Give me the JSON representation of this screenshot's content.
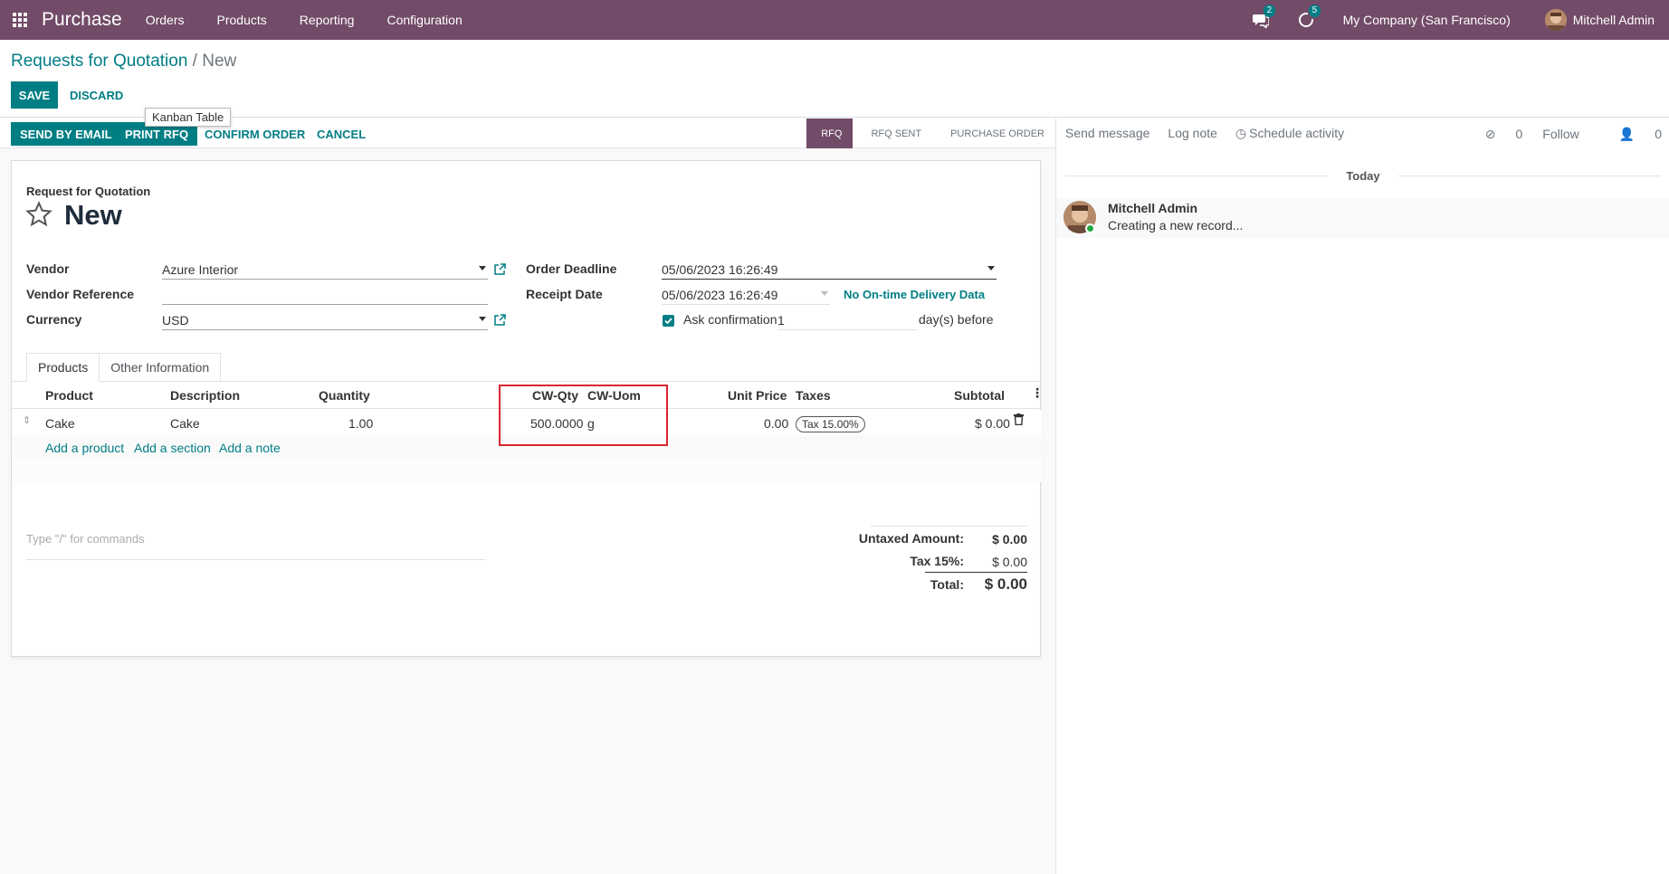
{
  "navbar": {
    "brand": "Purchase",
    "menu": [
      "Orders",
      "Products",
      "Reporting",
      "Configuration"
    ],
    "messages_badge": "2",
    "activities_badge": "5",
    "company": "My Company (San Francisco)",
    "user": "Mitchell Admin"
  },
  "breadcrumb": {
    "parent": "Requests for Quotation",
    "separator": "/",
    "current": "New"
  },
  "actions": {
    "save": "SAVE",
    "discard": "DISCARD"
  },
  "tooltip": "Kanban Table",
  "statusbar": {
    "send_email": "SEND BY EMAIL",
    "print_rfq": "PRINT RFQ",
    "confirm": "CONFIRM ORDER",
    "cancel": "CANCEL",
    "stages": [
      "RFQ",
      "RFQ SENT",
      "PURCHASE ORDER"
    ],
    "active_stage": "RFQ"
  },
  "chatter": {
    "send_message": "Send message",
    "log_note": "Log note",
    "schedule_activity": "Schedule activity",
    "attachments": "0",
    "follow": "Follow",
    "followers": "0",
    "date_separator": "Today",
    "message": {
      "author": "Mitchell Admin",
      "body": "Creating a new record..."
    }
  },
  "form": {
    "label": "Request for Quotation",
    "name": "New",
    "vendor_label": "Vendor",
    "vendor_value": "Azure Interior",
    "vendor_ref_label": "Vendor Reference",
    "vendor_ref_value": "",
    "currency_label": "Currency",
    "currency_value": "USD",
    "order_deadline_label": "Order Deadline",
    "order_deadline_value": "05/06/2023 16:26:49",
    "receipt_date_label": "Receipt Date",
    "receipt_date_value": "05/06/2023 16:26:49",
    "on_time_link": "No On-time Delivery Data",
    "ask_confirmation_label": "Ask confirmation",
    "ask_confirmation_checked": true,
    "confirmation_days": "1",
    "days_before": "day(s) before"
  },
  "tabs": [
    "Products",
    "Other Information"
  ],
  "table": {
    "headers": {
      "product": "Product",
      "description": "Description",
      "quantity": "Quantity",
      "cw_qty": "CW-Qty",
      "cw_uom": "CW-Uom",
      "unit_price": "Unit Price",
      "taxes": "Taxes",
      "subtotal": "Subtotal"
    },
    "rows": [
      {
        "product": "Cake",
        "description": "Cake",
        "quantity": "1.00",
        "cw_qty": "500.0000",
        "cw_uom": "g",
        "unit_price": "0.00",
        "tax": "Tax 15.00%",
        "subtotal": "$ 0.00"
      }
    ],
    "add_product": "Add a product",
    "add_section": "Add a section",
    "add_note": "Add a note"
  },
  "notes_placeholder": "Type \"/\" for commands",
  "totals": {
    "untaxed_label": "Untaxed Amount:",
    "untaxed_value": "$ 0.00",
    "tax_label": "Tax 15%:",
    "tax_value": "$ 0.00",
    "total_label": "Total:",
    "total_value": "$ 0.00"
  },
  "colors": {
    "brand": "#714b67",
    "accent": "#017e84",
    "highlight": "#d9262f"
  }
}
